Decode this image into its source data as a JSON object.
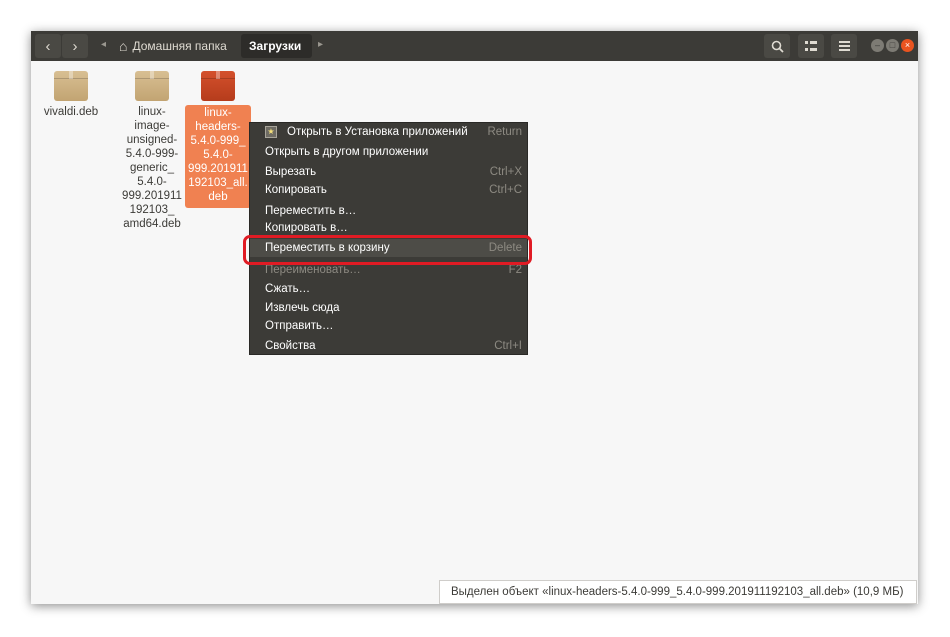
{
  "header": {
    "back_icon": "chevron-left",
    "forward_icon": "chevron-right",
    "breadcrumbs": [
      "Домашняя папка",
      "Загрузки"
    ],
    "search_icon": "search",
    "view_icon": "list-view",
    "menu_icon": "hamburger-menu"
  },
  "files": [
    {
      "name": "vivaldi.deb",
      "color": "#c9ad7c",
      "selected": false
    },
    {
      "name": "linux-\nimage-\nunsigned-\n5.4.0-999-\ngeneric_\n5.4.0-\n999.201911\n192103_\namd64.deb",
      "color": "#c9ad7c",
      "selected": false
    },
    {
      "name": "linux-\nheaders-\n5.4.0-999_\n5.4.0-\n999.201911\n192103_all.\ndeb",
      "color": "#c34627",
      "selected": true
    }
  ],
  "context_menu": {
    "items": [
      {
        "label": "Открыть в Установка приложений",
        "accel": "Return"
      },
      {
        "label": "Открыть в другом приложении",
        "accel": ""
      },
      {
        "label": "Вырезать",
        "accel": "Ctrl+X"
      },
      {
        "label": "Копировать",
        "accel": "Ctrl+C"
      },
      {
        "label": "Переместить в…",
        "accel": ""
      },
      {
        "label": "Копировать в…",
        "accel": ""
      },
      {
        "label": "Переместить в корзину",
        "accel": "Delete"
      },
      {
        "label": "Переименовать…",
        "accel": "F2"
      },
      {
        "label": "Сжать…",
        "accel": ""
      },
      {
        "label": "Извлечь сюда",
        "accel": ""
      },
      {
        "label": "Отправить…",
        "accel": ""
      },
      {
        "label": "Свойства",
        "accel": "Ctrl+I"
      }
    ],
    "highlight_color": "#e01b24"
  },
  "status": {
    "text": "Выделен объект «linux-headers-5.4.0-999_5.4.0-999.201911192103_all.deb» (10,9 МБ)"
  },
  "colors": {
    "header_bg": "#3c3b37",
    "selection": "#f08151",
    "close_button": "#e95420"
  }
}
